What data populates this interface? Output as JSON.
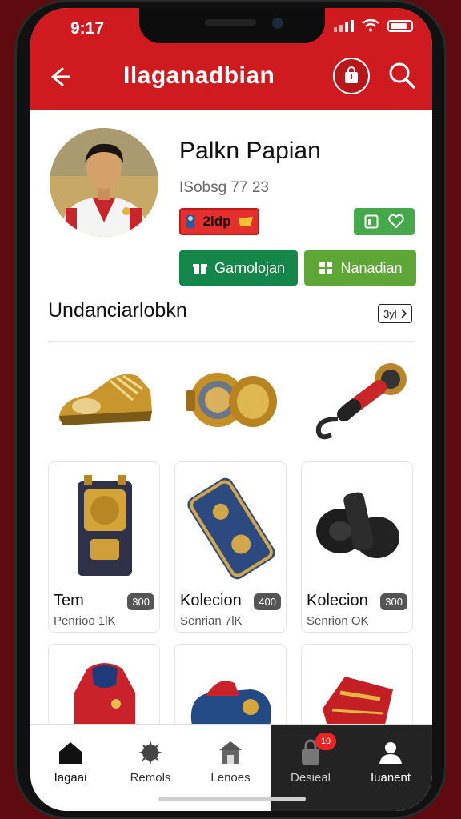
{
  "status_bar": {
    "time": "9:17"
  },
  "header": {
    "title": "Ilaganadbian"
  },
  "profile": {
    "name": "Palkn Papian",
    "subtitle": "ISobsg 77 23",
    "coins": "2ldp",
    "primary_button": "Garnolojan",
    "secondary_button": "Nanadian"
  },
  "section": {
    "title": "Undanciarlobkn",
    "see_all": "3yl"
  },
  "cards": [
    {
      "title": "Tem",
      "price": "300",
      "subtitle": "Penrioo 1lK"
    },
    {
      "title": "Kolecion",
      "price": "400",
      "subtitle": "Senrian 7lK"
    },
    {
      "title": "Kolecion",
      "price": "300",
      "subtitle": "Senrion OK"
    }
  ],
  "nav": [
    {
      "label": "Iagaai",
      "icon": "home-icon"
    },
    {
      "label": "Remols",
      "icon": "gear-icon"
    },
    {
      "label": "Lenoes",
      "icon": "store-icon"
    },
    {
      "label": "Desieal",
      "icon": "bag-icon",
      "badge": "10"
    },
    {
      "label": "Iuanent",
      "icon": "user-icon"
    }
  ],
  "colors": {
    "brand_red": "#cf1b1f",
    "green_dark": "#14864a",
    "green_light": "#5ea636"
  }
}
